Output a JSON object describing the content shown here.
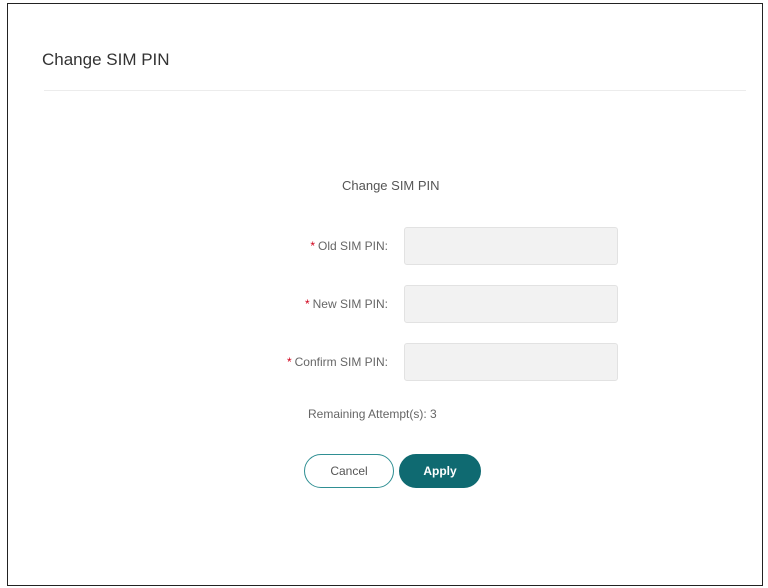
{
  "dialog": {
    "title": "Change SIM PIN"
  },
  "form": {
    "title": "Change SIM PIN",
    "required_marker": "*",
    "fields": [
      {
        "label": "Old SIM PIN:",
        "value": ""
      },
      {
        "label": "New SIM PIN:",
        "value": ""
      },
      {
        "label": "Confirm SIM PIN:",
        "value": ""
      }
    ],
    "remaining_attempts": "Remaining Attempt(s): 3"
  },
  "buttons": {
    "cancel_label": "Cancel",
    "apply_label": "Apply"
  },
  "colors": {
    "accent": "#0f6a71",
    "required": "#d0021b",
    "input_bg": "#f2f2f2"
  }
}
